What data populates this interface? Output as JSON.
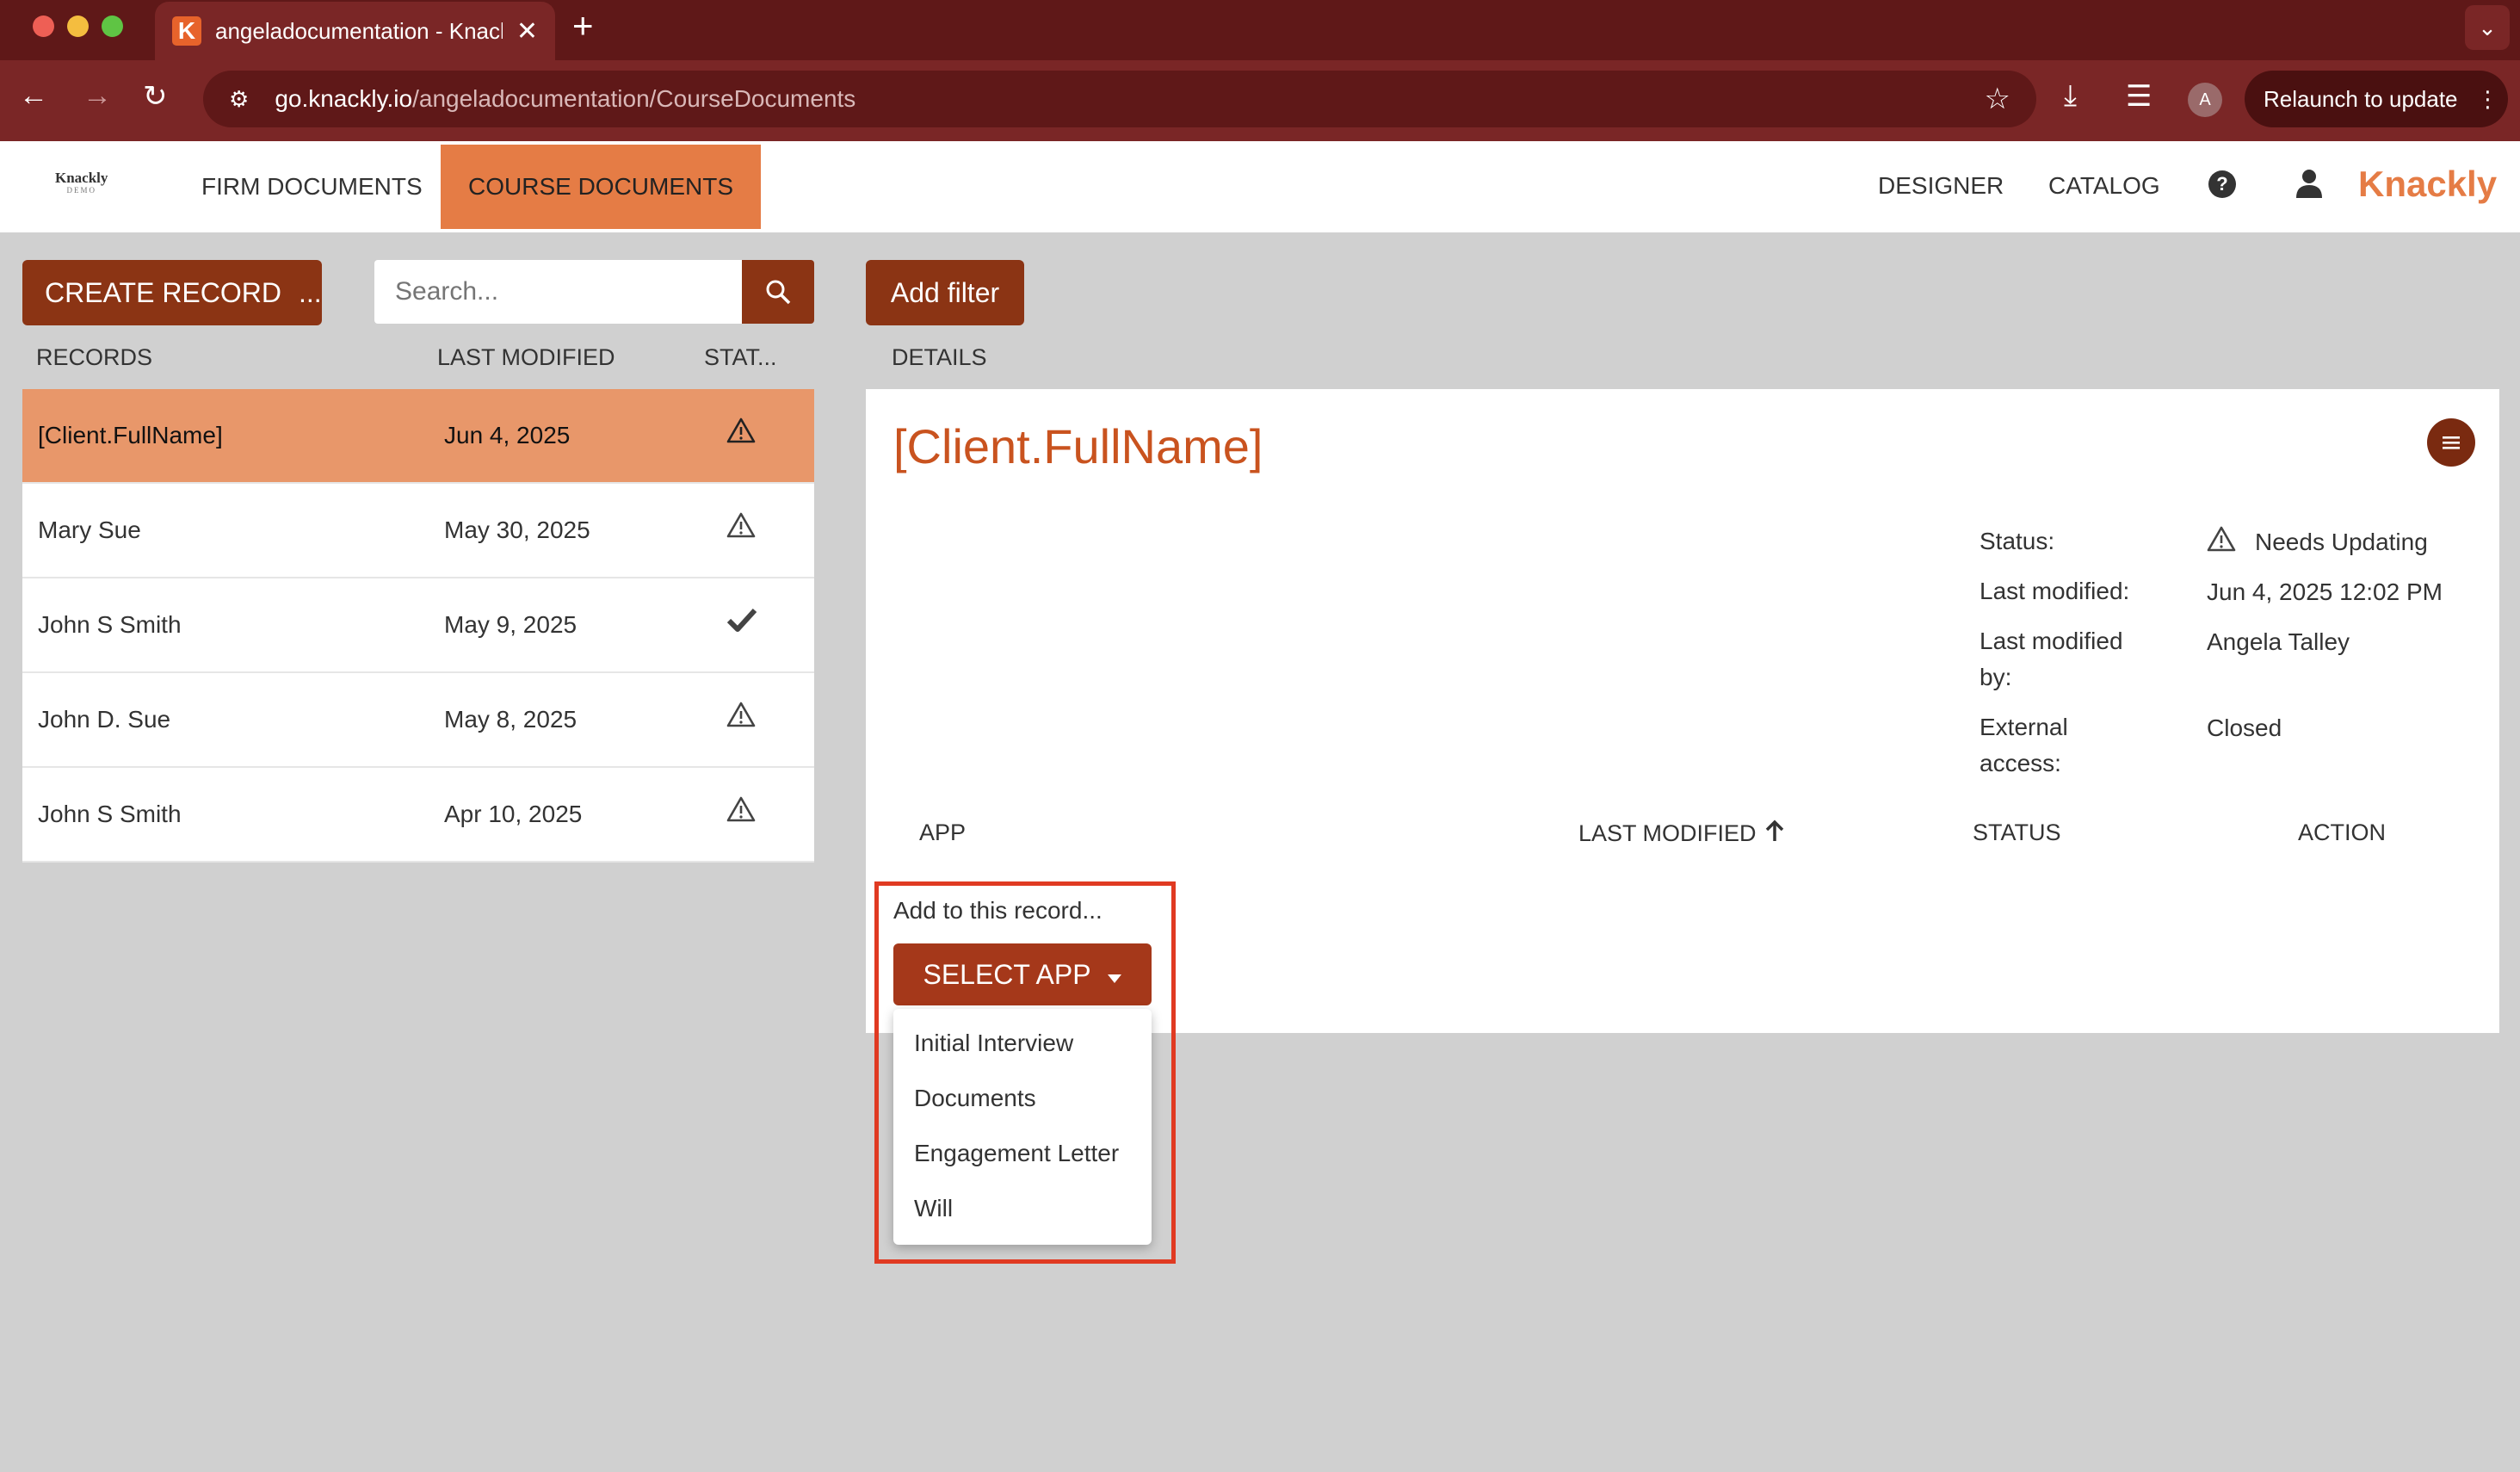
{
  "browser": {
    "tab_title": "angeladocumentation - Knackly",
    "favicon_letter": "K",
    "url_host": "go.knackly.io",
    "url_path": "/angeladocumentation/CourseDocuments",
    "avatar_letter": "A",
    "relaunch_label": "Relaunch to update"
  },
  "header": {
    "logo_text": "Knackly",
    "logo_sub": "DEMO",
    "nav": [
      {
        "label": "FIRM DOCUMENTS",
        "active": false
      },
      {
        "label": "COURSE DOCUMENTS",
        "active": true
      }
    ],
    "designer": "DESIGNER",
    "catalog": "CATALOG",
    "help": "?",
    "brand": "Knackly"
  },
  "records": {
    "create_label": "CREATE RECORD",
    "create_more": "...",
    "search_placeholder": "Search...",
    "columns": {
      "name": "RECORDS",
      "modified": "LAST MODIFIED",
      "status": "STAT..."
    },
    "rows": [
      {
        "name": "[Client.FullName]",
        "date": "Jun 4, 2025",
        "status": "warning",
        "selected": true
      },
      {
        "name": "Mary Sue",
        "date": "May 30, 2025",
        "status": "warning",
        "selected": false
      },
      {
        "name": "John S Smith",
        "date": "May 9, 2025",
        "status": "check",
        "selected": false
      },
      {
        "name": "John D. Sue",
        "date": "May 8, 2025",
        "status": "warning",
        "selected": false
      },
      {
        "name": "John S Smith",
        "date": "Apr 10, 2025",
        "status": "warning",
        "selected": false
      }
    ]
  },
  "details": {
    "add_filter": "Add filter",
    "label": "DETAILS",
    "title": "[Client.FullName]",
    "meta": {
      "status_label": "Status:",
      "status_value": "Needs Updating",
      "modified_label": "Last modified:",
      "modified_value": "Jun 4, 2025 12:02 PM",
      "by_label_1": "Last modified",
      "by_label_2": "by:",
      "by_value": "Angela Talley",
      "ext_label_1": "External",
      "ext_label_2": "access:",
      "ext_value": "Closed"
    },
    "table_headers": {
      "app": "APP",
      "modified": "LAST MODIFIED",
      "status": "STATUS",
      "action": "ACTION"
    },
    "add_prompt": "Add to this record...",
    "select_app": "SELECT APP",
    "apps": [
      "Initial Interview",
      "Documents",
      "Engagement Letter",
      "Will"
    ]
  },
  "colors": {
    "accent": "#e57c45",
    "dark_brown": "#8b3414",
    "title_orange": "#c9531f",
    "highlight_red": "#e03a22"
  }
}
